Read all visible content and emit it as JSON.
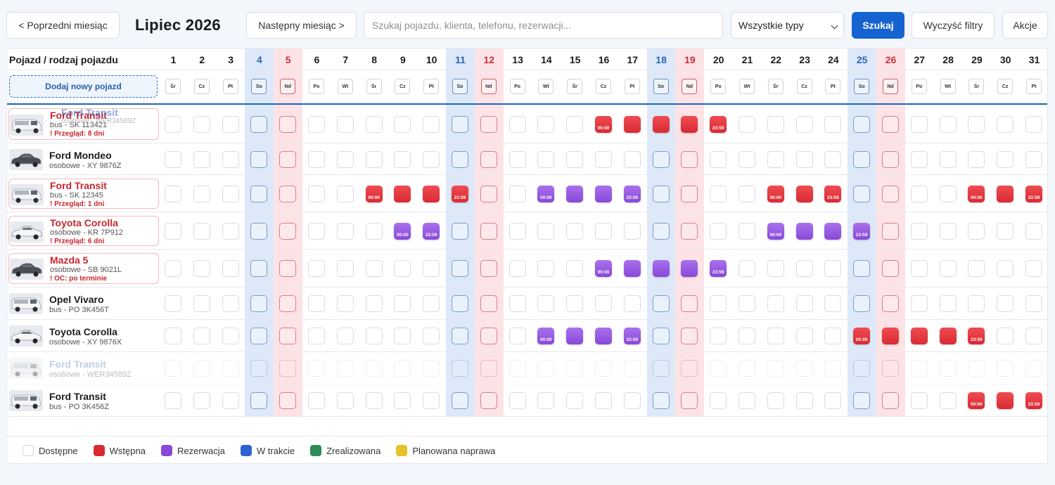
{
  "toolbar": {
    "prev_label": "< Poprzedni miesiąc",
    "month_title": "Lipiec 2026",
    "next_label": "Następny miesiąc >",
    "search_placeholder": "Szukaj pojazdu, klienta, telefonu, rezerwacji...",
    "type_select": "Wszystkie typy",
    "search_button": "Szukaj",
    "clear_button": "Wyczyść filtry",
    "actions_button": "Akcje"
  },
  "grid": {
    "vehicle_column_header": "Pojazd / rodzaj pojazdu",
    "add_vehicle_label": "Dodaj nowy pojazd",
    "days": [
      {
        "num": "1",
        "wd": "Śr"
      },
      {
        "num": "2",
        "wd": "Cz"
      },
      {
        "num": "3",
        "wd": "Pt"
      },
      {
        "num": "4",
        "wd": "So"
      },
      {
        "num": "5",
        "wd": "Nd"
      },
      {
        "num": "6",
        "wd": "Po"
      },
      {
        "num": "7",
        "wd": "Wt"
      },
      {
        "num": "8",
        "wd": "Śr"
      },
      {
        "num": "9",
        "wd": "Cz"
      },
      {
        "num": "10",
        "wd": "Pt"
      },
      {
        "num": "11",
        "wd": "So"
      },
      {
        "num": "12",
        "wd": "Nd"
      },
      {
        "num": "13",
        "wd": "Po"
      },
      {
        "num": "14",
        "wd": "Wt"
      },
      {
        "num": "15",
        "wd": "Śr"
      },
      {
        "num": "16",
        "wd": "Cz"
      },
      {
        "num": "17",
        "wd": "Pt"
      },
      {
        "num": "18",
        "wd": "So"
      },
      {
        "num": "19",
        "wd": "Nd"
      },
      {
        "num": "20",
        "wd": "Po"
      },
      {
        "num": "21",
        "wd": "Wt"
      },
      {
        "num": "22",
        "wd": "Śr"
      },
      {
        "num": "23",
        "wd": "Cz"
      },
      {
        "num": "24",
        "wd": "Pt"
      },
      {
        "num": "25",
        "wd": "So"
      },
      {
        "num": "26",
        "wd": "Nd"
      },
      {
        "num": "27",
        "wd": "Po"
      },
      {
        "num": "28",
        "wd": "Wt"
      },
      {
        "num": "29",
        "wd": "Śr"
      },
      {
        "num": "30",
        "wd": "Cz"
      },
      {
        "num": "31",
        "wd": "Pt"
      }
    ]
  },
  "vehicles": [
    {
      "name": "Ford Transit",
      "sub": "bus - SK 113421",
      "warning": "! Przegląd: 8 dni",
      "alert": true,
      "ghost": false,
      "overlay_name": "Ford Transit",
      "overlay_sub": "osobowe - WER34589Z",
      "bookings": [
        {
          "day": 16,
          "status": "wstepna",
          "time": "00:00"
        },
        {
          "day": 17,
          "status": "wstepna"
        },
        {
          "day": 18,
          "status": "wstepna"
        },
        {
          "day": 19,
          "status": "wstepna"
        },
        {
          "day": 20,
          "status": "wstepna",
          "time": "23:59"
        }
      ]
    },
    {
      "name": "Ford Mondeo",
      "sub": "osobowe - XY 9876Z",
      "warning": "",
      "alert": false,
      "ghost": false,
      "bookings": []
    },
    {
      "name": "Ford Transit",
      "sub": "bus - SK 12345",
      "warning": "! Przegląd: 1 dni",
      "alert": true,
      "ghost": false,
      "bookings": [
        {
          "day": 8,
          "status": "wstepna",
          "time": "00:00"
        },
        {
          "day": 9,
          "status": "wstepna"
        },
        {
          "day": 10,
          "status": "wstepna"
        },
        {
          "day": 11,
          "status": "wstepna",
          "time": "23:59"
        },
        {
          "day": 14,
          "status": "rezerwacja",
          "time": "00:00"
        },
        {
          "day": 15,
          "status": "rezerwacja"
        },
        {
          "day": 16,
          "status": "rezerwacja"
        },
        {
          "day": 17,
          "status": "rezerwacja",
          "time": "23:59"
        },
        {
          "day": 22,
          "status": "wstepna",
          "time": "00:00"
        },
        {
          "day": 23,
          "status": "wstepna"
        },
        {
          "day": 24,
          "status": "wstepna",
          "time": "23:59"
        },
        {
          "day": 29,
          "status": "wstepna",
          "time": "00:00"
        },
        {
          "day": 30,
          "status": "wstepna"
        },
        {
          "day": 31,
          "status": "wstepna",
          "time": "23:59"
        }
      ]
    },
    {
      "name": "Toyota Corolla",
      "sub": "osobowe - KR 7P912",
      "warning": "! Przegląd: 6 dni",
      "alert": true,
      "ghost": false,
      "bookings": [
        {
          "day": 9,
          "status": "rezerwacja",
          "time": "00:00"
        },
        {
          "day": 10,
          "status": "rezerwacja",
          "time": "23:59"
        },
        {
          "day": 22,
          "status": "rezerwacja",
          "time": "00:00"
        },
        {
          "day": 23,
          "status": "rezerwacja"
        },
        {
          "day": 24,
          "status": "rezerwacja"
        },
        {
          "day": 25,
          "status": "rezerwacja",
          "time": "23:59"
        }
      ]
    },
    {
      "name": "Mazda 5",
      "sub": "osobowe - SB 9021L",
      "warning": "! OC: po terminie",
      "alert": true,
      "ghost": false,
      "bookings": [
        {
          "day": 16,
          "status": "rezerwacja",
          "time": "00:00"
        },
        {
          "day": 17,
          "status": "rezerwacja"
        },
        {
          "day": 18,
          "status": "rezerwacja"
        },
        {
          "day": 19,
          "status": "rezerwacja"
        },
        {
          "day": 20,
          "status": "rezerwacja",
          "time": "23:59"
        }
      ]
    },
    {
      "name": "Opel Vivaro",
      "sub": "bus - PO 3K456T",
      "warning": "",
      "alert": false,
      "ghost": false,
      "bookings": []
    },
    {
      "name": "Toyota Corolla",
      "sub": "osobowe - XY 9876X",
      "warning": "",
      "alert": false,
      "ghost": false,
      "bookings": [
        {
          "day": 14,
          "status": "rezerwacja",
          "time": "00:00"
        },
        {
          "day": 15,
          "status": "rezerwacja"
        },
        {
          "day": 16,
          "status": "rezerwacja"
        },
        {
          "day": 17,
          "status": "rezerwacja",
          "time": "23:59"
        },
        {
          "day": 25,
          "status": "wstepna",
          "time": "00:00"
        },
        {
          "day": 26,
          "status": "wstepna"
        },
        {
          "day": 27,
          "status": "wstepna"
        },
        {
          "day": 28,
          "status": "wstepna"
        },
        {
          "day": 29,
          "status": "wstepna",
          "time": "23:59"
        }
      ]
    },
    {
      "name": "Ford Transit",
      "sub": "osobowe - WER34589Z",
      "warning": "",
      "alert": false,
      "ghost": true,
      "bookings": []
    },
    {
      "name": "Ford Transit",
      "sub": "bus - PO 3K456Z",
      "warning": "",
      "alert": false,
      "ghost": false,
      "bookings": [
        {
          "day": 29,
          "status": "wstepna",
          "time": "00:00"
        },
        {
          "day": 30,
          "status": "wstepna"
        },
        {
          "day": 31,
          "status": "wstepna",
          "time": "23:59"
        }
      ]
    }
  ],
  "legend": [
    {
      "label": "Dostępne",
      "color": "#ffffff"
    },
    {
      "label": "Wstępna",
      "color": "#d92a33"
    },
    {
      "label": "Rezerwacja",
      "color": "#8848d8"
    },
    {
      "label": "W trakcie",
      "color": "#2f62d0"
    },
    {
      "label": "Zrealizowana",
      "color": "#2e8b57"
    },
    {
      "label": "Planowana naprawa",
      "color": "#e6c229"
    }
  ]
}
